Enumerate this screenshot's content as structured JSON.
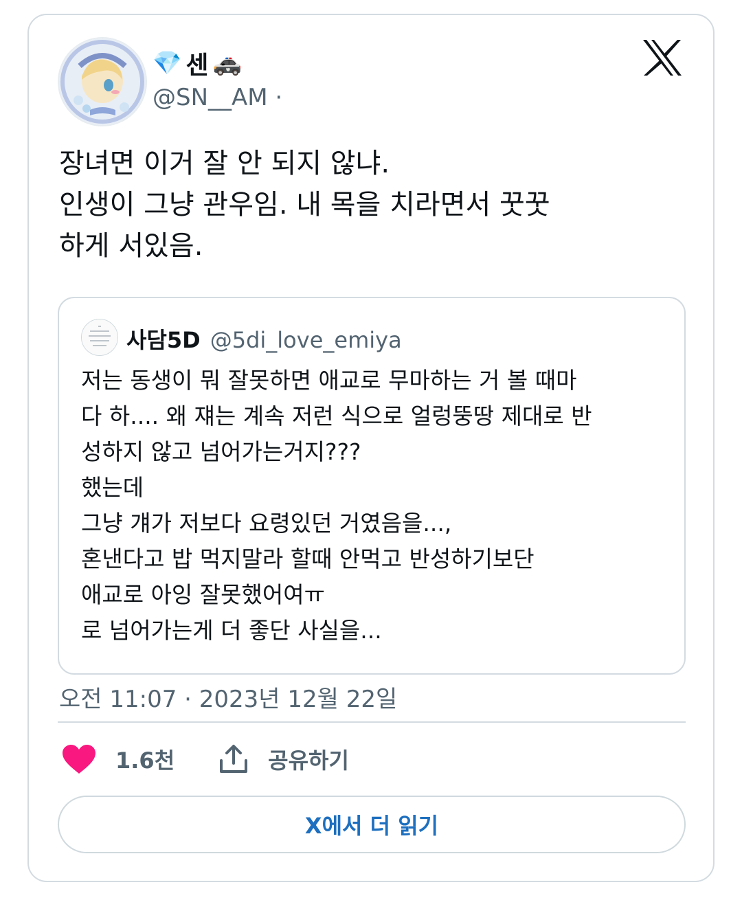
{
  "tweet": {
    "display_name": "센",
    "name_emoji_before": "💎",
    "name_emoji_after": "🚓",
    "handle": "@SN__AM",
    "handle_dot": "·",
    "text": "장녀면 이거 잘 안 되지 않냐.\n인생이 그냥 관우임. 내 목을 치라면서 꿋꿋\n하게 서있음.",
    "timestamp": "오전 11:07 · 2023년 12월 22일"
  },
  "quote": {
    "name": "사담5D",
    "handle": "@5di_love_emiya",
    "text": "저는 동생이 뭐 잘못하면 애교로 무마하는 거 볼 때마\n다 하.... 왜 쟤는 계속 저런 식으로 얼렁뚱땅 제대로 반\n성하지 않고 넘어가는거지???\n했는데\n그냥 걔가 저보다 요령있던 거였음을...,\n혼낸다고 밥 먹지말라 할때 안먹고 반성하기보단\n애교로 아잉 잘못했어여ㅠ\n로 넘어가는게 더 좋단 사실을..."
  },
  "actions": {
    "likes": "1.6천",
    "share_label": "공유하기"
  },
  "read_more_label": "X에서 더 읽기",
  "colors": {
    "heart": "#f91880",
    "link": "#1d6fbf",
    "muted": "#536471",
    "border": "#d3dbe1"
  }
}
